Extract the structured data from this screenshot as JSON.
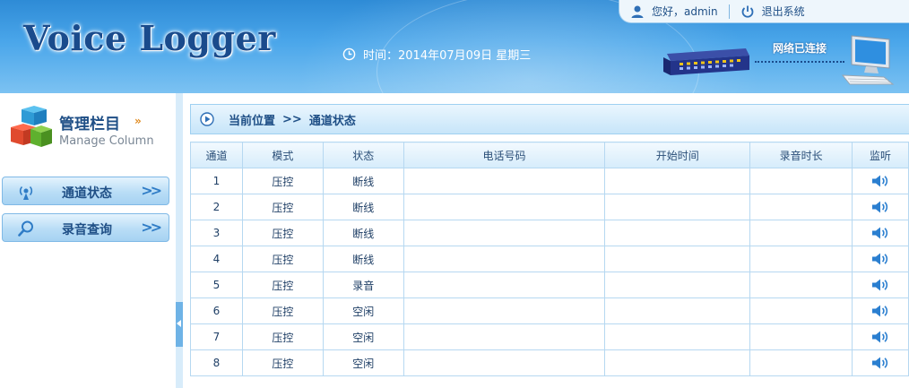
{
  "header": {
    "logo_text": "Voice Logger",
    "datetime": "时间：2014年07月09日 星期三",
    "greeting": "您好，admin",
    "logout": "退出系统",
    "network_status": "网络已连接"
  },
  "sidebar": {
    "title": "管理栏目",
    "subtitle": "Manage Column",
    "items": [
      {
        "label": "通道状态"
      },
      {
        "label": "录音查询"
      }
    ]
  },
  "breadcrumb": {
    "root": "当前位置",
    "separator": ">>",
    "current": "通道状态"
  },
  "table": {
    "columns": [
      "通道",
      "模式",
      "状态",
      "电话号码",
      "开始时间",
      "录音时长",
      "监听"
    ],
    "rows": [
      {
        "channel": "1",
        "mode": "压控",
        "status": "断线",
        "phone": "",
        "start": "",
        "duration": ""
      },
      {
        "channel": "2",
        "mode": "压控",
        "status": "断线",
        "phone": "",
        "start": "",
        "duration": ""
      },
      {
        "channel": "3",
        "mode": "压控",
        "status": "断线",
        "phone": "",
        "start": "",
        "duration": ""
      },
      {
        "channel": "4",
        "mode": "压控",
        "status": "断线",
        "phone": "",
        "start": "",
        "duration": ""
      },
      {
        "channel": "5",
        "mode": "压控",
        "status": "录音",
        "phone": "",
        "start": "",
        "duration": ""
      },
      {
        "channel": "6",
        "mode": "压控",
        "status": "空闲",
        "phone": "",
        "start": "",
        "duration": ""
      },
      {
        "channel": "7",
        "mode": "压控",
        "status": "空闲",
        "phone": "",
        "start": "",
        "duration": ""
      },
      {
        "channel": "8",
        "mode": "压控",
        "status": "空闲",
        "phone": "",
        "start": "",
        "duration": ""
      }
    ]
  },
  "icons": {
    "user": "user-icon",
    "power": "power-icon",
    "clock": "clock-icon",
    "speaker": "speaker-icon"
  },
  "colors": {
    "header_blue": "#2e8bd6",
    "text_navy": "#1f4f86",
    "grid_border": "#b6d8f1",
    "speaker_blue": "#2b7fd0"
  }
}
